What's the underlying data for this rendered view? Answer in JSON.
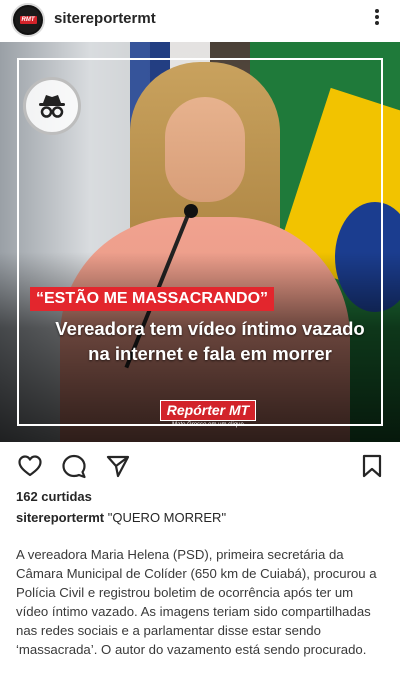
{
  "header": {
    "username": "sitereportermt",
    "avatar_icon": "reporter-mt-logo-icon",
    "more_icon": "more-vertical-icon"
  },
  "post": {
    "quote_tag": "“ESTÃO ME MASSACRANDO”",
    "headline": "Vereadora tem vídeo íntimo vazado na internet e fala em morrer",
    "brand_name": "Repórter MT",
    "brand_tagline": "Mato Grosso em um clique",
    "badge_icon": "incognito-icon",
    "colors": {
      "accent_red": "#e3262d",
      "brand_red": "#d2232a"
    }
  },
  "actions": {
    "like_icon": "heart-icon",
    "comment_icon": "comment-icon",
    "share_icon": "send-icon",
    "save_icon": "bookmark-icon"
  },
  "likes_text": "162 curtidas",
  "caption": {
    "user": "sitereportermt",
    "text": "\"QUERO MORRER\""
  },
  "body_text": "A vereadora Maria Helena (PSD), primeira secretária da Câmara Municipal de Colíder (650 km de Cuiabá), procurou a Polícia Civil e registrou boletim de ocorrência após ter um vídeo íntimo vazado. As imagens teriam sido compartilhadas nas redes sociais e a parlamentar disse estar sendo ‘massacrada’. O autor do vazamento está sendo procurado."
}
